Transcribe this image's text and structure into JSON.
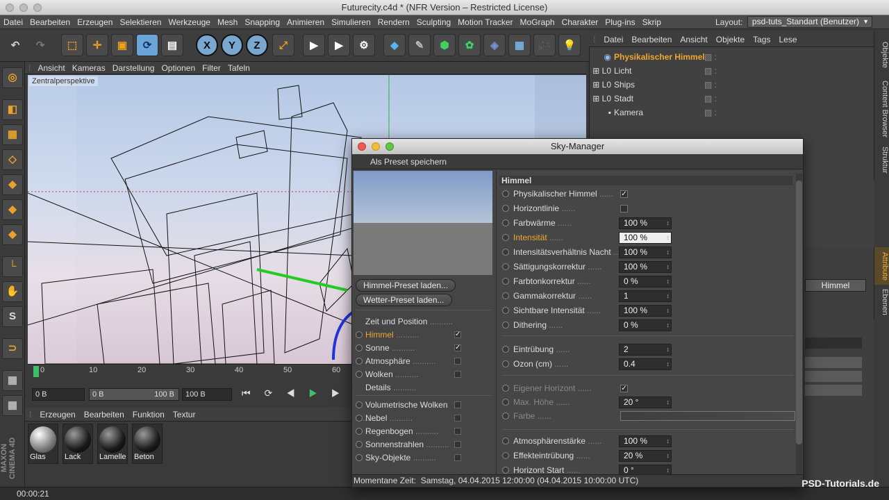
{
  "window": {
    "title": "Futurecity.c4d * (NFR Version – Restricted License)"
  },
  "menubar": {
    "items": [
      "Datei",
      "Bearbeiten",
      "Erzeugen",
      "Selektieren",
      "Werkzeuge",
      "Mesh",
      "Snapping",
      "Animieren",
      "Simulieren",
      "Rendern",
      "Sculpting",
      "Motion Tracker",
      "MoGraph",
      "Charakter",
      "Plug-ins",
      "Skrip"
    ],
    "layout_label": "Layout:",
    "layout_value": "psd-tuts_Standart (Benutzer)"
  },
  "toolbar": {
    "x": "X",
    "y": "Y",
    "z": "Z"
  },
  "viewport": {
    "menu": [
      "Ansicht",
      "Kameras",
      "Darstellung",
      "Optionen",
      "Filter",
      "Tafeln"
    ],
    "camera_label": "Zentralperspektive"
  },
  "objects": {
    "menu": [
      "Datei",
      "Bearbeiten",
      "Ansicht",
      "Objekte",
      "Tags",
      "Lese"
    ],
    "items": [
      {
        "name": "Physikalischer Himmel",
        "selected": true
      },
      {
        "name": "Licht"
      },
      {
        "name": "Ships"
      },
      {
        "name": "Stadt"
      },
      {
        "name": "Kamera"
      }
    ]
  },
  "side_tabs": {
    "top": [
      "Objekte",
      "Content Browser",
      "Struktur"
    ],
    "bottom": [
      "Attribute",
      "Ebenen"
    ]
  },
  "attributes": {
    "tab": "Himmel"
  },
  "timeline": {
    "ticks": [
      "0",
      "10",
      "20",
      "30",
      "40",
      "50",
      "60"
    ],
    "start": "0 B",
    "min": "0 B",
    "max": "100 B",
    "end": "100 B"
  },
  "materials": {
    "menu": [
      "Erzeugen",
      "Bearbeiten",
      "Funktion",
      "Textur"
    ],
    "items": [
      "Glas",
      "Lack",
      "Lamelle",
      "Beton"
    ]
  },
  "status": {
    "time": "00:00:21"
  },
  "branding": {
    "maxon": "MAXON CINEMA 4D",
    "watermark": "PSD-Tutorials.de"
  },
  "dialog": {
    "title": "Sky-Manager",
    "preset_save": "Als Preset speichern",
    "btn_sky_preset": "Himmel-Preset laden...",
    "btn_weather_preset": "Wetter-Preset laden...",
    "nav": [
      {
        "label": "Zeit und Position",
        "radio": false,
        "checkbox": null
      },
      {
        "label": "Himmel",
        "radio": true,
        "checkbox": true,
        "active": true
      },
      {
        "label": "Sonne",
        "radio": true,
        "checkbox": true
      },
      {
        "label": "Atmosphäre",
        "radio": true,
        "checkbox": false
      },
      {
        "label": "Wolken",
        "radio": true,
        "checkbox": false
      },
      {
        "label": "Details",
        "radio": false,
        "checkbox": null
      },
      {
        "label": "Volumetrische Wolken",
        "radio": true,
        "checkbox": false
      },
      {
        "label": "Nebel",
        "radio": true,
        "checkbox": false
      },
      {
        "label": "Regenbogen",
        "radio": true,
        "checkbox": false
      },
      {
        "label": "Sonnenstrahlen",
        "radio": true,
        "checkbox": false
      },
      {
        "label": "Sky-Objekte",
        "radio": true,
        "checkbox": false
      }
    ],
    "section": "Himmel",
    "params1": [
      {
        "label": "Physikalischer Himmel",
        "type": "cb",
        "checked": true
      },
      {
        "label": "Horizontlinie",
        "type": "cb",
        "checked": false
      },
      {
        "label": "Farbwärme",
        "value": "100 %"
      },
      {
        "label": "Intensität",
        "value": "100 %",
        "highlight": true
      },
      {
        "label": "Intensitätsverhältnis Nacht",
        "value": "100 %"
      },
      {
        "label": "Sättigungskorrektur",
        "value": "100 %"
      },
      {
        "label": "Farbtonkorrektur",
        "value": "0 %"
      },
      {
        "label": "Gammakorrektur",
        "value": "1"
      },
      {
        "label": "Sichtbare Intensität",
        "value": "100 %"
      },
      {
        "label": "Dithering",
        "value": "0 %"
      }
    ],
    "params2": [
      {
        "label": "Eintrübung",
        "value": "2"
      },
      {
        "label": "Ozon (cm)",
        "value": "0.4"
      }
    ],
    "params3": [
      {
        "label": "Eigener Horizont",
        "type": "cb",
        "checked": true
      },
      {
        "label": "Max. Höhe",
        "value": "20 °"
      },
      {
        "label": "Farbe",
        "type": "gradient"
      }
    ],
    "params4": [
      {
        "label": "Atmosphärenstärke",
        "value": "100 %"
      },
      {
        "label": "Effekteintrübung",
        "value": "20 %"
      },
      {
        "label": "Horizont Start",
        "value": "0 °"
      }
    ],
    "status_label": "Momentane Zeit:",
    "status_value": "Samstag, 04.04.2015  12:00:00  (04.04.2015  10:00:00 UTC)"
  }
}
